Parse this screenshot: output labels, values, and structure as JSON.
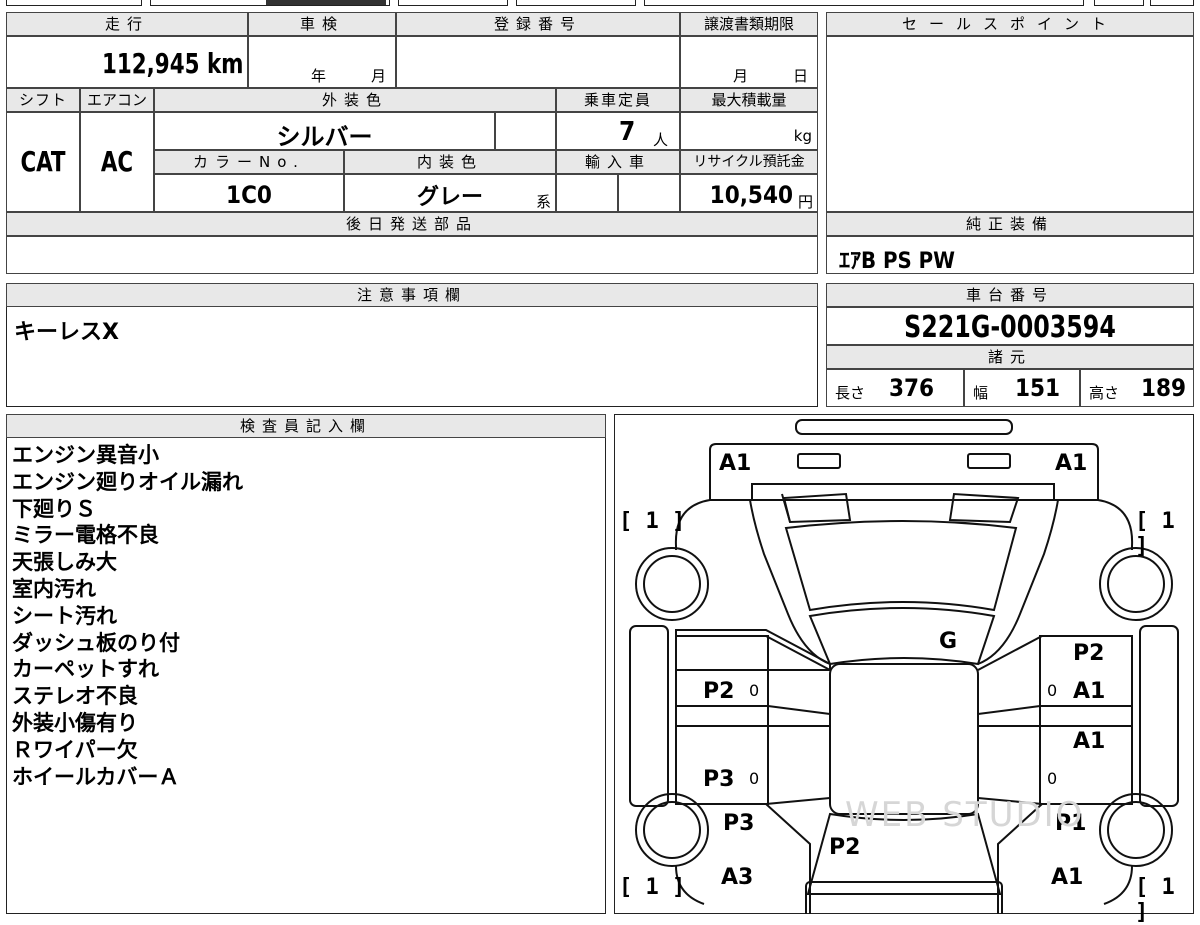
{
  "header_row1": {
    "mileage_label": "走行",
    "mileage_value": "112,945 km",
    "inspection_label": "車検",
    "inspection_year": "年",
    "inspection_month": "月",
    "registration_label": "登録番号",
    "transfer_deadline_label": "譲渡書類期限",
    "transfer_month": "月",
    "transfer_day": "日"
  },
  "header_row2": {
    "shift_label": "シフト",
    "shift_value": "CAT",
    "ac_label": "エアコン",
    "ac_value": "AC",
    "exterior_color_label": "外装色",
    "exterior_color_value": "シルバー",
    "capacity_label": "乗車定員",
    "capacity_value": "7",
    "capacity_unit": "人",
    "max_load_label": "最大積載量",
    "max_load_unit": "kg",
    "color_no_label": "カラーNo.",
    "color_no_value": "1C0",
    "interior_color_label": "内装色",
    "interior_color_value": "グレー",
    "interior_suffix": "系",
    "import_label": "輸入車",
    "recycle_label": "リサイクル預託金",
    "recycle_value": "10,540",
    "recycle_unit": "円"
  },
  "later_parts_label": "後日発送部品",
  "sales_point_label": "セールスポイント",
  "genuine_equipment_label": "純正装備",
  "genuine_equipment_value": "ｴｱB PS PW",
  "notes_label": "注意事項欄",
  "notes_value": "キーレスX",
  "chassis_label": "車台番号",
  "chassis_value": "S221G-0003594",
  "specs_label": "諸元",
  "specs": {
    "length_label": "長さ",
    "length_value": "376",
    "width_label": "幅",
    "width_value": "151",
    "height_label": "高さ",
    "height_value": "189"
  },
  "inspector_label": "検査員記入欄",
  "inspector_notes": [
    "エンジン異音小",
    "エンジン廻りオイル漏れ",
    "下廻りＳ",
    "ミラー電格不良",
    "天張しみ大",
    "室内汚れ",
    "シート汚れ",
    "ダッシュ板のり付",
    "カーペットすれ",
    "ステレオ不良",
    "外装小傷有り",
    "Ｒワイパー欠",
    "ホイールカバーＡ"
  ],
  "diagram": {
    "front_left": "A1",
    "front_right": "A1",
    "tire_fl": "1",
    "tire_fr": "1",
    "tire_rl": "1",
    "tire_rr": "1",
    "windshield": "G",
    "left_front_door": "P2",
    "left_front_zero": "0",
    "left_rear_door": "P3",
    "left_rear_zero": "0",
    "left_rear_quarter": "P3",
    "left_rear_bumper": "A3",
    "rear_center": "P2",
    "right_front_top": "P2",
    "right_front_door": "A1",
    "right_front_zero": "0",
    "right_rear_door": "A1",
    "right_rear_zero": "0",
    "right_rear_quarter": "P1",
    "right_rear_bumper": "A1",
    "watermark": "WEB STUDIO"
  }
}
